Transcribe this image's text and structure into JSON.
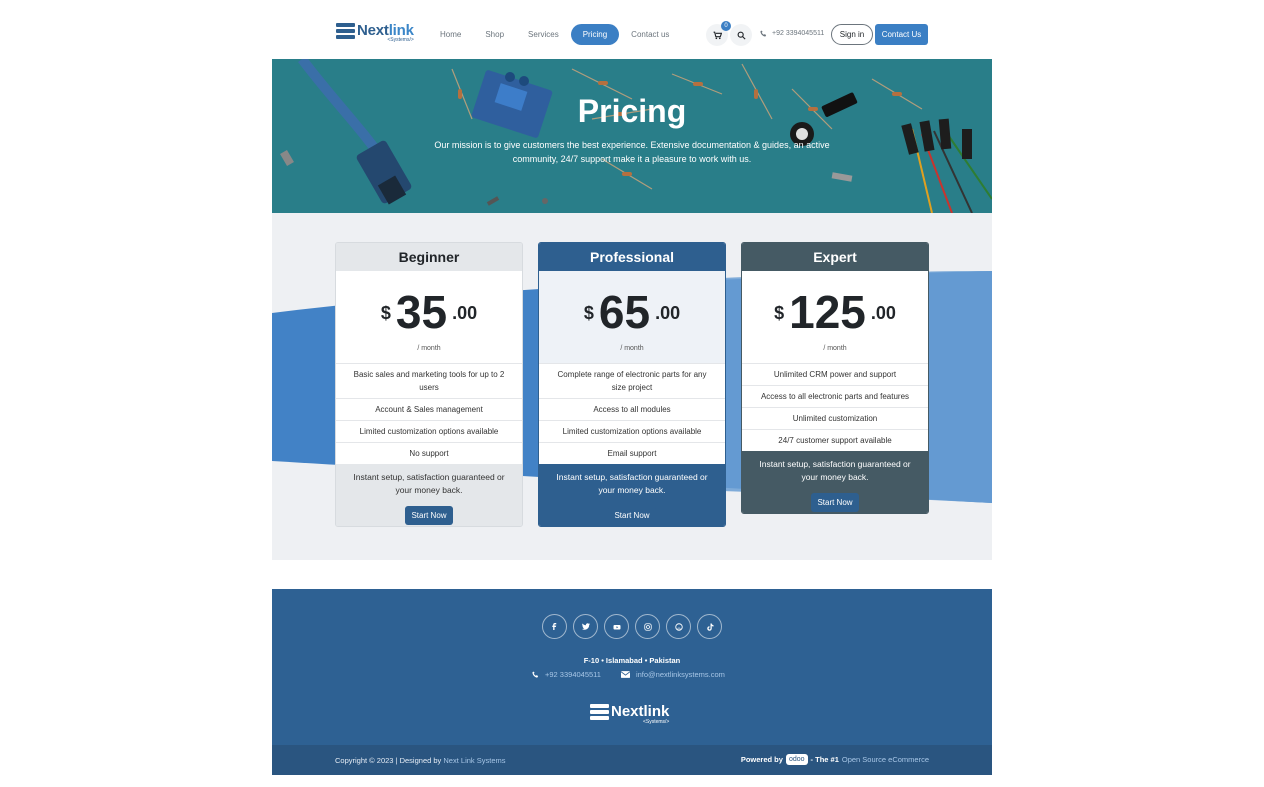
{
  "brand": {
    "name_part1": "Next",
    "name_part2": "link",
    "tagline": "<Systems/>"
  },
  "nav": {
    "items": [
      {
        "label": "Home",
        "active": false
      },
      {
        "label": "Shop",
        "active": false
      },
      {
        "label": "Services",
        "active": false
      },
      {
        "label": "Pricing",
        "active": true
      },
      {
        "label": "Contact us",
        "active": false
      }
    ],
    "cart_count": "0",
    "phone": "+92 3394045511",
    "sign_in": "Sign in",
    "contact_button": "Contact Us"
  },
  "hero": {
    "title": "Pricing",
    "subtitle": "Our mission is to give customers the best experience. Extensive documentation & guides, an active community, 24/7 support make it a pleasure to work with us."
  },
  "plans": [
    {
      "name": "Beginner",
      "currency": "$",
      "amount": "35",
      "decimals": ".00",
      "period": "/ month",
      "features": [
        "Basic sales and marketing tools for up to 2 users",
        "Account & Sales management",
        "Limited customization options available",
        "No support"
      ],
      "note": "Instant setup, satisfaction guaranteed or your money back.",
      "cta": "Start Now"
    },
    {
      "name": "Professional",
      "currency": "$",
      "amount": "65",
      "decimals": ".00",
      "period": "/ month",
      "features": [
        "Complete range of electronic parts for any size project",
        "Access to all modules",
        "Limited customization options available",
        "Email support"
      ],
      "note": "Instant setup, satisfaction guaranteed or your money back.",
      "cta": "Start Now"
    },
    {
      "name": "Expert",
      "currency": "$",
      "amount": "125",
      "decimals": ".00",
      "period": "/ month",
      "features": [
        "Unlimited CRM power and support",
        "Access to all electronic parts and features",
        "Unlimited customization",
        "24/7 customer support available"
      ],
      "note": "Instant setup, satisfaction guaranteed or your money back.",
      "cta": "Start Now"
    }
  ],
  "footer": {
    "socials": [
      "facebook-icon",
      "twitter-icon",
      "youtube-icon",
      "instagram-icon",
      "github-icon",
      "tiktok-icon"
    ],
    "address": "F-10 • Islamabad • Pakistan",
    "phone": "+92 3394045511",
    "email": "info@nextlinksystems.com",
    "copyright": "Copyright © 2023 | Designed by",
    "designer": "Next Link Systems",
    "powered_by": "Powered by",
    "odoo": "odoo",
    "the_number_one": "- The #1",
    "ecommerce": "Open Source eCommerce"
  },
  "colors": {
    "primary": "#3b7fc4",
    "dark_blue": "#2e5f8f",
    "slate": "#455a64",
    "footer": "#2e6193"
  }
}
